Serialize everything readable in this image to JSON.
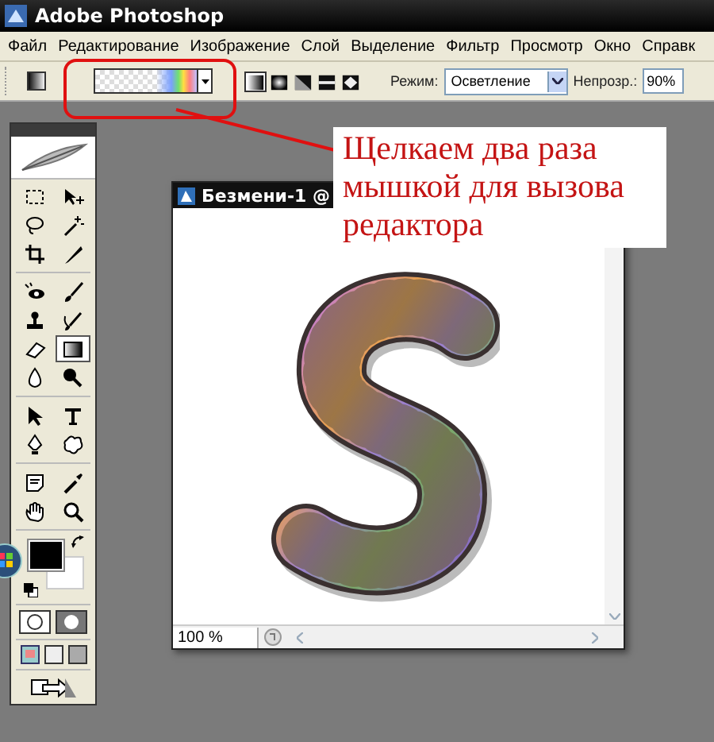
{
  "window": {
    "title": "Adobe Photoshop"
  },
  "menu": [
    "Файл",
    "Редактирование",
    "Изображение",
    "Слой",
    "Выделение",
    "Фильтр",
    "Просмотр",
    "Окно",
    "Справк"
  ],
  "options_bar": {
    "gradient_types": [
      {
        "selected": true
      },
      {
        "selected": false
      },
      {
        "selected": false
      },
      {
        "selected": false
      },
      {
        "selected": false
      }
    ],
    "mode_label": "Режим:",
    "mode_value": "Осветление",
    "opacity_label": "Непрозр.:",
    "opacity_value": "90%"
  },
  "tools": [
    {
      "selected": false
    },
    {
      "selected": false
    },
    {
      "selected": false
    },
    {
      "selected": false
    },
    {
      "selected": false
    },
    {
      "selected": false
    },
    {
      "selected": false
    },
    {
      "selected": false
    },
    {
      "selected": false
    },
    {
      "selected": false
    },
    {
      "selected": false
    },
    {
      "selected": true
    },
    {
      "selected": false
    },
    {
      "selected": false
    },
    {
      "selected": false
    },
    {
      "selected": false
    },
    {
      "selected": false
    },
    {
      "selected": false
    },
    {
      "selected": false
    },
    {
      "selected": false
    },
    {
      "selected": false
    },
    {
      "selected": false
    }
  ],
  "document": {
    "title": "Безмени-1 @",
    "zoom": "100 %"
  },
  "callout": {
    "text": "Щелкаем два раза мышкой для вызова редактора"
  }
}
